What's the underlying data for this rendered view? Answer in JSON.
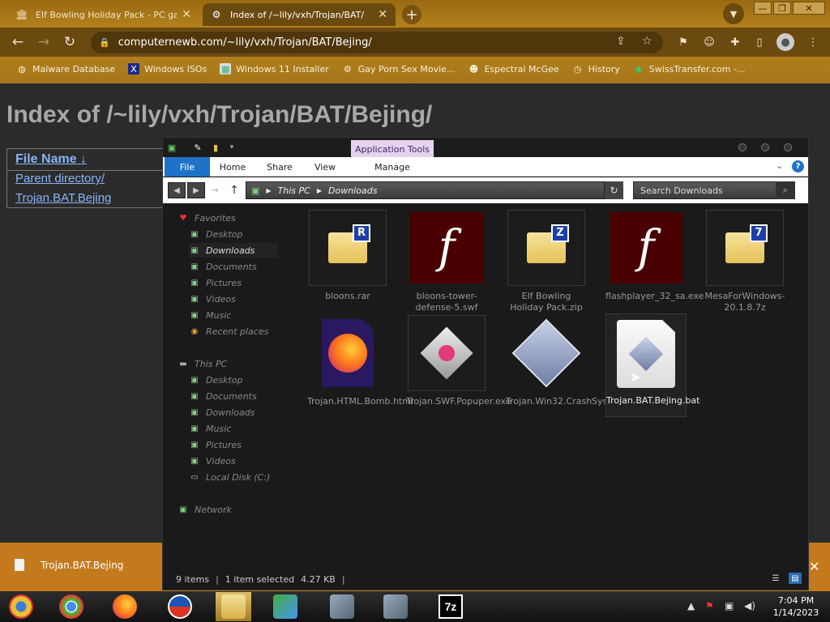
{
  "browser": {
    "tabs": [
      {
        "title": "Elf Bowling Holiday Pack - PC gam",
        "close": "✕",
        "active": false
      },
      {
        "title": "Index of /~lily/vxh/Trojan/BAT/",
        "close": "✕",
        "active": true
      }
    ],
    "new_tab": "+",
    "window_controls": {
      "minimize": "—",
      "restore": "❐",
      "close": "✕"
    },
    "url": "computernewb.com/~lily/vxh/Trojan/BAT/Bejing/",
    "bookmarks": [
      {
        "label": "Malware Database",
        "icon": "globe-icon"
      },
      {
        "label": "Windows ISOs",
        "icon": "x-logo-icon"
      },
      {
        "label": "Windows 11 Installer",
        "icon": "image-icon"
      },
      {
        "label": "Gay Porn Sex Movie...",
        "icon": "gear-icon"
      },
      {
        "label": "Espectral McGee",
        "icon": "avatar-icon"
      },
      {
        "label": "History",
        "icon": "history-icon"
      },
      {
        "label": "SwissTransfer.com -...",
        "icon": "transfer-icon"
      }
    ]
  },
  "page": {
    "heading": "Index of /~lily/vxh/Trojan/BAT/Bejing/",
    "column_header": "File Name",
    "sort_indicator": "↓",
    "links": [
      "Parent directory/",
      "Trojan.BAT.Bejing"
    ]
  },
  "download_bar": {
    "filename": "Trojan.BAT.Bejing",
    "close": "✕"
  },
  "explorer": {
    "context_tab": "Application Tools",
    "ribbon_tabs": [
      "File",
      "Home",
      "Share",
      "View",
      "Manage"
    ],
    "breadcrumb": [
      "This PC",
      "Downloads"
    ],
    "search_placeholder": "Search Downloads",
    "nav": {
      "favorites_label": "Favorites",
      "favorites": [
        "Desktop",
        "Downloads",
        "Documents",
        "Pictures",
        "Videos",
        "Music",
        "Recent places"
      ],
      "thispc_label": "This PC",
      "thispc": [
        "Desktop",
        "Documents",
        "Downloads",
        "Music",
        "Pictures",
        "Videos",
        "Local Disk (C:)"
      ],
      "network_label": "Network",
      "selected": "Downloads"
    },
    "files": [
      {
        "name": "bloons.rar",
        "kind": "archive",
        "badge": "R",
        "icon": "rar-archive-icon"
      },
      {
        "name": "bloons-tower-defense-5.swf",
        "kind": "flash",
        "badge": "f",
        "icon": "flash-icon"
      },
      {
        "name": "Elf Bowling Holiday Pack.zip",
        "kind": "archive",
        "badge": "Z",
        "icon": "zip-archive-icon"
      },
      {
        "name": "flashplayer_32_sa.exe",
        "kind": "flash",
        "badge": "f",
        "icon": "flash-icon"
      },
      {
        "name": "MesaForWindows-20.1.8.7z",
        "kind": "archive",
        "badge": "7",
        "icon": "7z-archive-icon"
      },
      {
        "name": "Trojan.HTML.Bomb.html",
        "kind": "firefox",
        "icon": "firefox-icon"
      },
      {
        "name": "Trojan.SWF.Popuper.exe",
        "kind": "gem",
        "icon": "app-icon"
      },
      {
        "name": "Trojan.Win32.CrashSystem.exe",
        "kind": "diamond",
        "icon": "app-icon"
      },
      {
        "name": "Trojan.BAT.Bejing.bat",
        "kind": "bat",
        "icon": "batch-file-icon",
        "selected": true
      }
    ],
    "status": {
      "count": "9 items",
      "selected": "1 item selected",
      "size": "4.27 KB"
    }
  },
  "taskbar": {
    "apps": [
      {
        "name": "chrome-canary",
        "icon": "chrome-canary-icon"
      },
      {
        "name": "chrome",
        "icon": "chrome-icon"
      },
      {
        "name": "firefox",
        "icon": "firefox-icon"
      },
      {
        "name": "obama",
        "icon": "obama-logo-icon"
      },
      {
        "name": "explorer",
        "icon": "file-explorer-icon",
        "active": true
      },
      {
        "name": "network",
        "icon": "network-app-icon"
      },
      {
        "name": "installer1",
        "icon": "installer-icon"
      },
      {
        "name": "installer2",
        "icon": "installer-icon"
      },
      {
        "name": "7zip",
        "icon": "7zip-icon",
        "label": "7z"
      }
    ],
    "time": "7:04 PM",
    "date": "1/14/2023"
  },
  "colors": {
    "accent": "#1e73c8",
    "chrome": "#6b4a10",
    "download_bar": "#c47a1c",
    "link": "#8ab4f8"
  }
}
